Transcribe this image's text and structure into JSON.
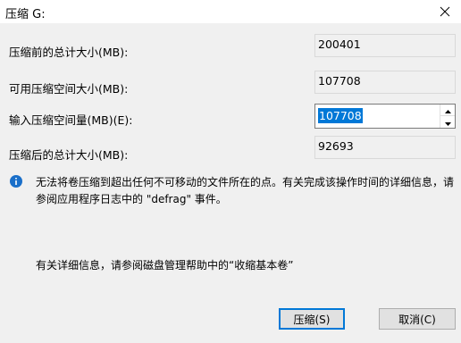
{
  "window": {
    "title": "压缩 G:",
    "close_icon": "close-icon"
  },
  "fields": [
    {
      "label": "压缩前的总计大小(MB):",
      "value": "200401"
    },
    {
      "label": "可用压缩空间大小(MB):",
      "value": "107708"
    },
    {
      "label": "输入压缩空间量(MB)(E):",
      "value": "107708"
    },
    {
      "label": "压缩后的总计大小(MB):",
      "value": "92693"
    }
  ],
  "info": {
    "icon": "info-icon",
    "text": "无法将卷压缩到超出任何不可移动的文件所在的点。有关完成该操作时间的详细信息，请参阅应用程序日志中的 \"defrag\" 事件。"
  },
  "help": {
    "text": "有关详细信息，请参阅磁盘管理帮助中的“收缩基本卷”"
  },
  "buttons": {
    "ok": "压缩(S)",
    "cancel": "取消(C)"
  },
  "colors": {
    "accent": "#0078d7",
    "info_icon": "#1a6fc9",
    "selection": "#0078d7"
  }
}
